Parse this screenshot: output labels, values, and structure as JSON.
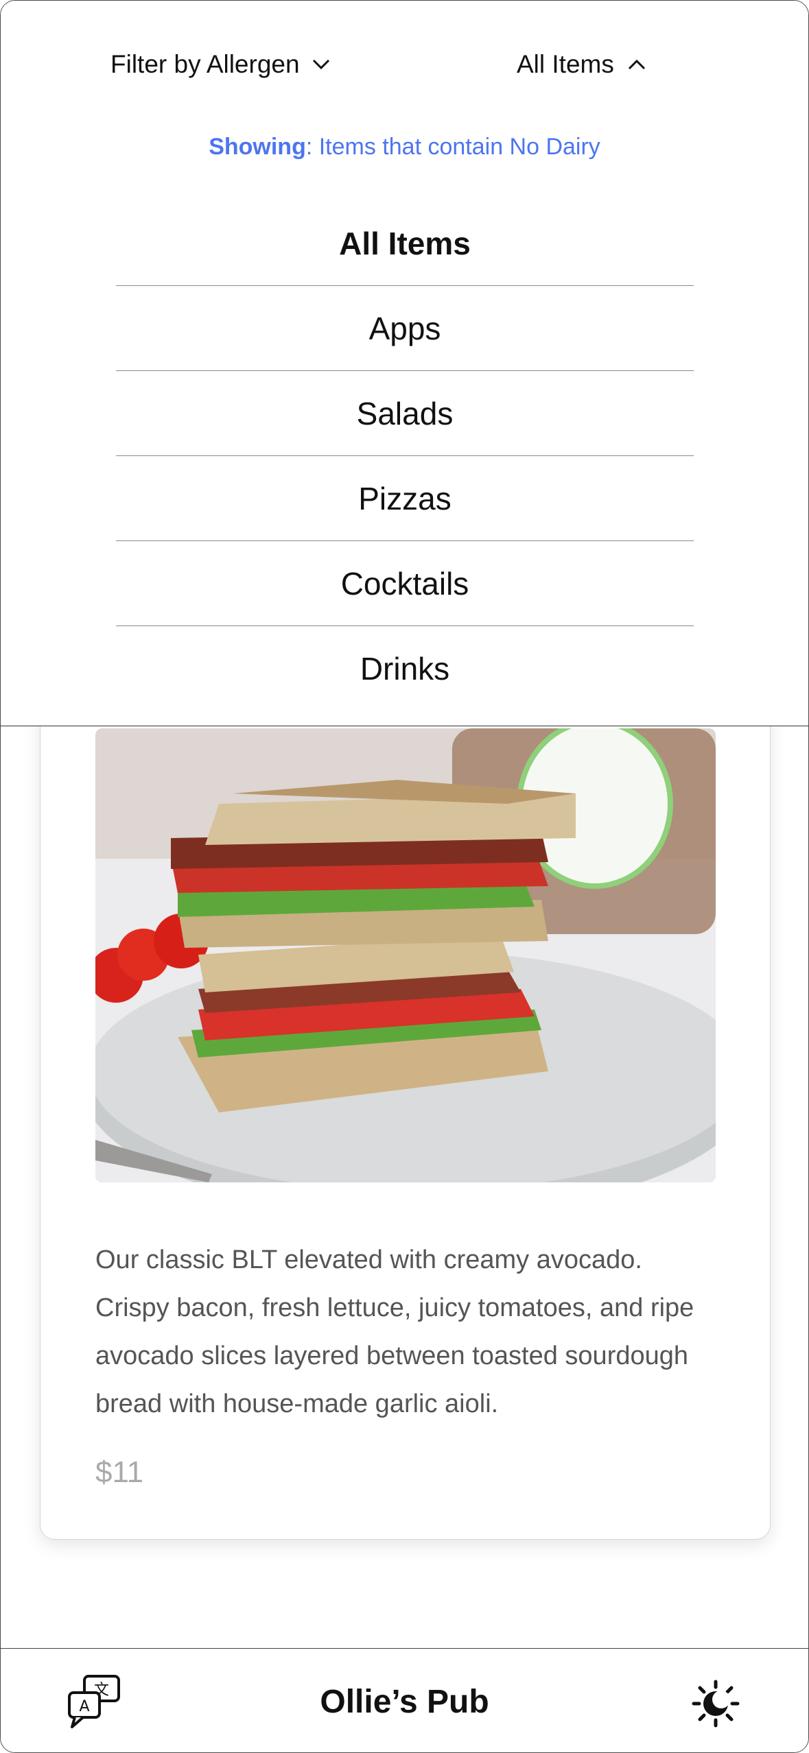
{
  "filter": {
    "label": "Filter by Allergen",
    "icon": "chevron-down-icon"
  },
  "category": {
    "label": "All Items",
    "icon": "chevron-up-icon"
  },
  "showing": {
    "prefix": "Showing",
    "text": ": Items that contain No Dairy",
    "color": "#4d75f0"
  },
  "menu": {
    "selected": "All Items",
    "items": [
      "All Items",
      "Apps",
      "Salads",
      "Pizzas",
      "Cocktails",
      "Drinks"
    ]
  },
  "card": {
    "image_icon": "blt-sandwich-photo",
    "description": "Our classic BLT elevated with creamy avocado. Crispy bacon, fresh lettuce, juicy tomatoes, and ripe avocado slices layered between toasted sourdough bread with house-made garlic aioli.",
    "price": "$11"
  },
  "bottom_bar": {
    "title": "Ollie’s Pub",
    "left_icon": "translate-icon",
    "right_icon": "theme-toggle-icon"
  }
}
